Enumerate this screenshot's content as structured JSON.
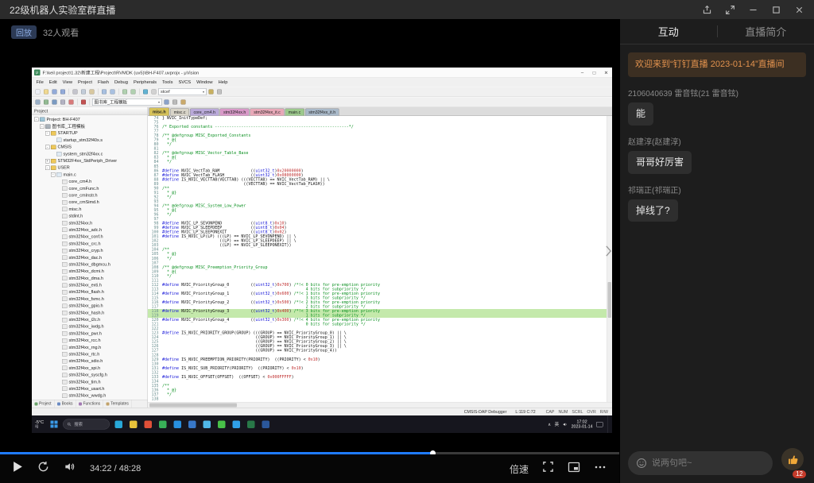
{
  "app": {
    "title": "22级机器人实验室群直播",
    "replay_badge": "回放",
    "viewer_count": "32人观看"
  },
  "player": {
    "time_display": "34:22 / 48:28",
    "speed_label": "倍速",
    "progress_percent": 70,
    "progress_color": "#1f7bff"
  },
  "sidebar": {
    "tabs": [
      {
        "label": "互动",
        "active": true
      },
      {
        "label": "直播简介",
        "active": false
      }
    ],
    "welcome": "欢迎来到“钉钉直播 2023-01-14”直播间",
    "messages": [
      {
        "name": "2106040639 雷音铉(21 雷音铉)",
        "text": "能"
      },
      {
        "name": "赵建淳(赵建淳)",
        "text": "哥哥好厉害"
      },
      {
        "name": "祁瑞正(祁瑞正)",
        "text": "掉线了?"
      }
    ],
    "input_placeholder": "说两句吧~",
    "like_count": "12",
    "accent_orange": "#e2924e"
  },
  "keil": {
    "window_title": "F:\\keil project\\1.32\\新建工程\\Project\\RVMDK (uv5)\\BH-F407.uvprojx - μVision",
    "logo_glyph": "μ",
    "window_controls": {
      "minimize": "–",
      "maximize": "□",
      "close": "✕"
    },
    "menus": [
      "File",
      "Edit",
      "View",
      "Project",
      "Flash",
      "Debug",
      "Peripherals",
      "Tools",
      "SVCS",
      "Window",
      "Help"
    ],
    "toolbar1a": [
      {
        "n": "new-file",
        "c": "#eef0f6"
      },
      {
        "n": "open-file",
        "c": "#f0d890"
      },
      {
        "n": "save",
        "c": "#92aad8"
      },
      {
        "n": "save-all",
        "c": "#92aad8"
      },
      "sep",
      {
        "n": "cut",
        "c": "#c4c4cc"
      },
      {
        "n": "copy",
        "c": "#c2ccd8"
      },
      {
        "n": "paste",
        "c": "#d8c8a0"
      },
      "sep",
      {
        "n": "undo",
        "c": "#a8c0e0"
      },
      {
        "n": "redo",
        "c": "#a8c0e0"
      },
      "sep",
      {
        "n": "jump-back",
        "c": "#b0d0b0"
      },
      {
        "n": "jump-forward",
        "c": "#b0d0b0"
      },
      "sep",
      {
        "n": "bookmark",
        "c": "#62b2d2"
      },
      {
        "n": "find",
        "c": "#d2d2d2"
      }
    ],
    "toolbar_input": "stcef",
    "toolbar1b": [
      {
        "n": "find-in-files",
        "c": "#c8b060"
      },
      {
        "n": "incremental-find",
        "c": "#c2c2c2"
      }
    ],
    "toolbar2a": [
      {
        "n": "translate",
        "c": "#9ab0c8"
      },
      {
        "n": "build",
        "c": "#92ba92"
      },
      {
        "n": "rebuild",
        "c": "#7a9ac2"
      },
      {
        "n": "batch-build",
        "c": "#b2b2c2"
      },
      {
        "n": "stop-build",
        "c": "#d87a7a"
      },
      "sep",
      {
        "n": "download",
        "c": "#c25252"
      },
      "sep"
    ],
    "target_select": "图书库_工程模板",
    "toolbar2b": [
      {
        "n": "target-options",
        "c": "#8aa2ca"
      },
      {
        "n": "file-extensions",
        "c": "#bababa"
      },
      {
        "n": "manage-books",
        "c": "#caa96a"
      }
    ],
    "panel_header": "Project",
    "panel_tabs": [
      {
        "label": "Project",
        "color": "#6aa26a"
      },
      {
        "label": "Books",
        "color": "#6a8ac2"
      },
      {
        "label": "Functions",
        "color": "#a27ab2"
      },
      {
        "label": "Templates",
        "color": "#c2a26a"
      }
    ],
    "tree": [
      {
        "t": "Project: BH-F407",
        "l": 0,
        "ic": "root",
        "e": "-"
      },
      {
        "t": "图书库_工程模板",
        "l": 1,
        "ic": "target",
        "e": "-"
      },
      {
        "t": "STARTUP",
        "l": 2,
        "ic": "folder",
        "e": "-"
      },
      {
        "t": "startup_stm32f40x.s",
        "l": 3,
        "ic": "file"
      },
      {
        "t": "CMSIS",
        "l": 2,
        "ic": "folder",
        "e": "-"
      },
      {
        "t": "system_stm32f4xx.c",
        "l": 3,
        "ic": "file"
      },
      {
        "t": "STM32F4xx_StdPeriph_Driver",
        "l": 2,
        "ic": "folder",
        "e": "+"
      },
      {
        "t": "USER",
        "l": 2,
        "ic": "folder",
        "e": "-"
      },
      {
        "t": "main.c",
        "l": 3,
        "ic": "file",
        "e": "-"
      },
      {
        "t": "core_cm4.h",
        "l": 4,
        "ic": "hfile"
      },
      {
        "t": "core_cmFunc.h",
        "l": 4,
        "ic": "hfile"
      },
      {
        "t": "core_cmInstr.h",
        "l": 4,
        "ic": "hfile"
      },
      {
        "t": "core_cmSimd.h",
        "l": 4,
        "ic": "hfile"
      },
      {
        "t": "misc.h",
        "l": 4,
        "ic": "hfile"
      },
      {
        "t": "stdint.h",
        "l": 4,
        "ic": "hfile"
      },
      {
        "t": "stm32f4xx.h",
        "l": 4,
        "ic": "hfile"
      },
      {
        "t": "stm32f4xx_adc.h",
        "l": 4,
        "ic": "hfile"
      },
      {
        "t": "stm32f4xx_conf.h",
        "l": 4,
        "ic": "hfile"
      },
      {
        "t": "stm32f4xx_crc.h",
        "l": 4,
        "ic": "hfile"
      },
      {
        "t": "stm32f4xx_cryp.h",
        "l": 4,
        "ic": "hfile"
      },
      {
        "t": "stm32f4xx_dac.h",
        "l": 4,
        "ic": "hfile"
      },
      {
        "t": "stm32f4xx_dbgmcu.h",
        "l": 4,
        "ic": "hfile"
      },
      {
        "t": "stm32f4xx_dcmi.h",
        "l": 4,
        "ic": "hfile"
      },
      {
        "t": "stm32f4xx_dma.h",
        "l": 4,
        "ic": "hfile"
      },
      {
        "t": "stm32f4xx_exti.h",
        "l": 4,
        "ic": "hfile"
      },
      {
        "t": "stm32f4xx_flash.h",
        "l": 4,
        "ic": "hfile"
      },
      {
        "t": "stm32f4xx_fsmc.h",
        "l": 4,
        "ic": "hfile"
      },
      {
        "t": "stm32f4xx_gpio.h",
        "l": 4,
        "ic": "hfile"
      },
      {
        "t": "stm32f4xx_hash.h",
        "l": 4,
        "ic": "hfile"
      },
      {
        "t": "stm32f4xx_i2c.h",
        "l": 4,
        "ic": "hfile"
      },
      {
        "t": "stm32f4xx_iwdg.h",
        "l": 4,
        "ic": "hfile"
      },
      {
        "t": "stm32f4xx_pwr.h",
        "l": 4,
        "ic": "hfile"
      },
      {
        "t": "stm32f4xx_rcc.h",
        "l": 4,
        "ic": "hfile"
      },
      {
        "t": "stm32f4xx_rng.h",
        "l": 4,
        "ic": "hfile"
      },
      {
        "t": "stm32f4xx_rtc.h",
        "l": 4,
        "ic": "hfile"
      },
      {
        "t": "stm32f4xx_sdio.h",
        "l": 4,
        "ic": "hfile"
      },
      {
        "t": "stm32f4xx_spi.h",
        "l": 4,
        "ic": "hfile"
      },
      {
        "t": "stm32f4xx_syscfg.h",
        "l": 4,
        "ic": "hfile"
      },
      {
        "t": "stm32f4xx_tim.h",
        "l": 4,
        "ic": "hfile"
      },
      {
        "t": "stm32f4xx_usart.h",
        "l": 4,
        "ic": "hfile"
      },
      {
        "t": "stm32f4xx_wwdg.h",
        "l": 4,
        "ic": "hfile"
      }
    ],
    "editor_tabs": [
      {
        "label": "misc.h",
        "bg": "#d6c25a",
        "active": true
      },
      {
        "label": "misc.c",
        "bg": "#d8d4c8"
      },
      {
        "label": "core_cm4.h",
        "bg": "#b9a9d9"
      },
      {
        "label": "stm32f4xx.h",
        "bg": "#d898c8"
      },
      {
        "label": "stm32f4xx_it.c",
        "bg": "#e8a8b8"
      },
      {
        "label": "main.c",
        "bg": "#9cc98c"
      },
      {
        "label": "stm32f4xx_it.h",
        "bg": "#a9b9c9"
      }
    ],
    "code_start": 74,
    "highlight_lines": [
      118,
      119
    ],
    "code": [
      "} NVIC_InitTypeDef;",
      "",
      "/* Exported constants --------------------------------------------------------*/",
      "",
      "/** @defgroup MISC_Exported_Constants",
      "  * @{",
      "  */",
      "",
      "/** @defgroup MISC_Vector_Table_Base",
      "  * @{",
      "  */",
      "",
      "#define NVIC_VectTab_RAM             ((uint32_t)0x20000000)",
      "#define NVIC_VectTab_FLASH           ((uint32_t)0x08000000)",
      "#define IS_NVIC_VECTTAB(VECTTAB) (((VECTTAB) == NVIC_VectTab_RAM) || \\",
      "                                  ((VECTTAB) == NVIC_VectTab_FLASH))",
      "/**",
      "  * @}",
      "  */",
      "",
      "/** @defgroup MISC_System_Low_Power",
      "  * @{",
      "  */",
      "",
      "#define NVIC_LP_SEVONPEND            ((uint8_t)0x10)",
      "#define NVIC_LP_SLEEPDEEP            ((uint8_t)0x04)",
      "#define NVIC_LP_SLEEPONEXIT          ((uint8_t)0x02)",
      "#define IS_NVIC_LP(LP) (((LP) == NVIC_LP_SEVONPEND) || \\",
      "                        ((LP) == NVIC_LP_SLEEPDEEP) || \\",
      "                        ((LP) == NVIC_LP_SLEEPONEXIT))",
      "/**",
      "  * @}",
      "  */",
      "",
      "/** @defgroup MISC_Preemption_Priority_Group",
      "  * @{",
      "  */",
      "",
      "#define NVIC_PriorityGroup_0         ((uint32_t)0x700) /*!< 0 bits for pre-emption priority",
      "                                                            4 bits for subpriority */",
      "#define NVIC_PriorityGroup_1         ((uint32_t)0x600) /*!< 1 bits for pre-emption priority",
      "                                                            3 bits for subpriority */",
      "#define NVIC_PriorityGroup_2         ((uint32_t)0x500) /*!< 2 bits for pre-emption priority",
      "                                                            2 bits for subpriority */",
      "#define NVIC_PriorityGroup_3         ((uint32_t)0x400) /*!< 3 bits for pre-emption priority",
      "                                                            1 bits for subpriority */",
      "#define NVIC_PriorityGroup_4         ((uint32_t)0x300) /*!< 4 bits for pre-emption priority",
      "                                                            0 bits for subpriority */",
      "",
      "#define IS_NVIC_PRIORITY_GROUP(GROUP) (((GROUP) == NVIC_PriorityGroup_0) || \\",
      "                                       ((GROUP) == NVIC_PriorityGroup_1) || \\",
      "                                       ((GROUP) == NVIC_PriorityGroup_2) || \\",
      "                                       ((GROUP) == NVIC_PriorityGroup_3) || \\",
      "                                       ((GROUP) == NVIC_PriorityGroup_4))",
      "",
      "#define IS_NVIC_PREEMPTION_PRIORITY(PRIORITY)  ((PRIORITY) < 0x10)",
      "",
      "#define IS_NVIC_SUB_PRIORITY(PRIORITY)  ((PRIORITY) < 0x10)",
      "",
      "#define IS_NVIC_OFFSET(OFFSET)  ((OFFSET) < 0x000FFFFF)",
      "",
      "/**",
      "  * @}",
      "  */",
      ""
    ],
    "status": {
      "debugger": "CMSIS-DAP Debugger",
      "cursor": "L:119 C:72",
      "flags": [
        "CAP",
        "NUM",
        "SCRL",
        "OVR",
        "R/W"
      ]
    }
  },
  "taskbar": {
    "weather_temp": "-5°C",
    "weather_text": "晴",
    "search_label": "搜索",
    "icons": [
      {
        "n": "edge",
        "c": "#28a8d8"
      },
      {
        "n": "file-explorer",
        "c": "#e8c23a"
      },
      {
        "n": "chrome",
        "c": "#e05038"
      },
      {
        "n": "360-browser",
        "c": "#38b058"
      },
      {
        "n": "store",
        "c": "#2890e0"
      },
      {
        "n": "mail",
        "c": "#3878c8"
      },
      {
        "n": "photos",
        "c": "#50b8e8"
      },
      {
        "n": "wechat",
        "c": "#48c048"
      },
      {
        "n": "qq",
        "c": "#30a0e8"
      },
      {
        "n": "keil-uvision",
        "c": "#287848"
      },
      {
        "n": "word",
        "c": "#2b579a"
      }
    ],
    "tray": {
      "chevron": "∧",
      "ime": "英",
      "time": "17:02",
      "date": "2023-01-14"
    }
  }
}
